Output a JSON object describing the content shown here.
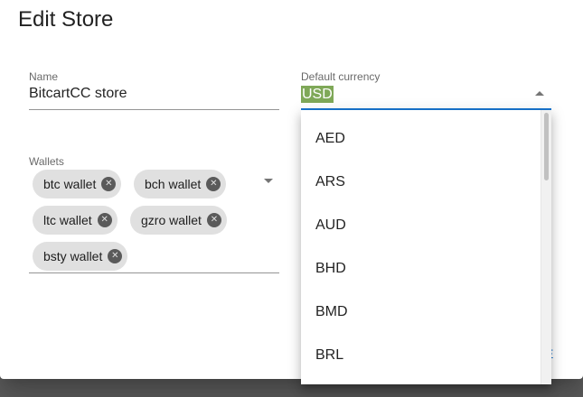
{
  "dialog": {
    "title": "Edit Store",
    "footer_button_label": "E"
  },
  "name_field": {
    "label": "Name",
    "value": "BitcartCC store"
  },
  "currency_field": {
    "label": "Default currency",
    "value": "USD"
  },
  "wallets_field": {
    "label": "Wallets",
    "chips": [
      "btc wallet",
      "bch wallet",
      "ltc wallet",
      "gzro wallet",
      "bsty wallet"
    ]
  },
  "currency_menu": {
    "options": [
      "AED",
      "ARS",
      "AUD",
      "BHD",
      "BMD",
      "BRL"
    ]
  },
  "colors": {
    "accent": "#1976d2",
    "selection": "#7fa858",
    "chip": "#e0e0e0"
  }
}
